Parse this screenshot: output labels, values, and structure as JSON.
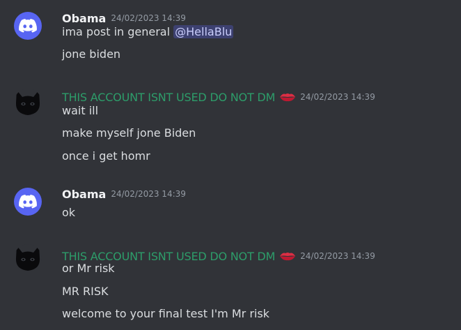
{
  "messages": [
    {
      "author": "Obama",
      "timestamp": "24/02/2023 14:39",
      "avatar_icon": "discord-logo-icon",
      "lines": [
        {
          "text": "ima post in general ",
          "mention": "@HellaBlu"
        },
        {
          "text": "jone biden"
        }
      ]
    },
    {
      "author": "THIS ACCOUNT ISNT USED DO NOT DM",
      "author_emoji": "kiss-mark-icon",
      "author_color": "#2d9d6a",
      "timestamp": "24/02/2023 14:39",
      "avatar_icon": "black-cat-avatar",
      "lines": [
        {
          "text": "wait ill"
        },
        {
          "text": "make myself jone Biden"
        },
        {
          "text": "once i get homr"
        }
      ]
    },
    {
      "author": "Obama",
      "timestamp": "24/02/2023 14:39",
      "avatar_icon": "discord-logo-icon",
      "lines": [
        {
          "text": "ok"
        }
      ]
    },
    {
      "author": "THIS ACCOUNT ISNT USED DO NOT DM",
      "author_emoji": "kiss-mark-icon",
      "author_color": "#2d9d6a",
      "timestamp": "24/02/2023 14:39",
      "avatar_icon": "black-cat-avatar",
      "lines": [
        {
          "text": "or Mr risk"
        },
        {
          "text": "MR RISK"
        },
        {
          "text": "welcome to your final test I'm Mr risk"
        }
      ]
    }
  ],
  "colors": {
    "background": "#313338",
    "discord_blurple": "#5865f2",
    "text": "#dbdee1",
    "timestamp": "#949ba4"
  }
}
